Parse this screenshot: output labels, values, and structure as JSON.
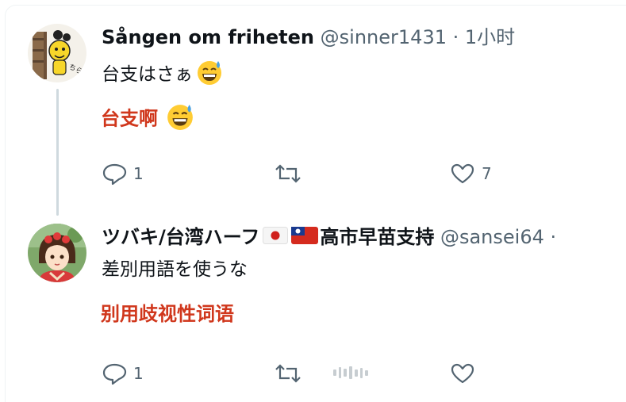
{
  "tweets": [
    {
      "name": "Sången om friheten",
      "handle": "@sinner1431",
      "separator": "·",
      "time": "1小时",
      "text": "台支はさぁ",
      "translation": "台支啊",
      "replies": "1",
      "likes": "7",
      "emoji": "grinning-face-with-sweat-icon"
    },
    {
      "name": "ツバキ/台湾ハーフ",
      "name_suffix": "高市早苗支持",
      "handle": "@sansei64",
      "separator": "·",
      "text": "差別用語を使うな",
      "translation": "别用歧视性词语",
      "replies": "1",
      "flags": [
        "japan-flag-icon",
        "taiwan-flag-icon"
      ]
    }
  ],
  "colors": {
    "translation": "#d0371c",
    "muted": "#536471",
    "thread_line": "#cfd9de",
    "emoji_yellow": "#ffcc33"
  }
}
